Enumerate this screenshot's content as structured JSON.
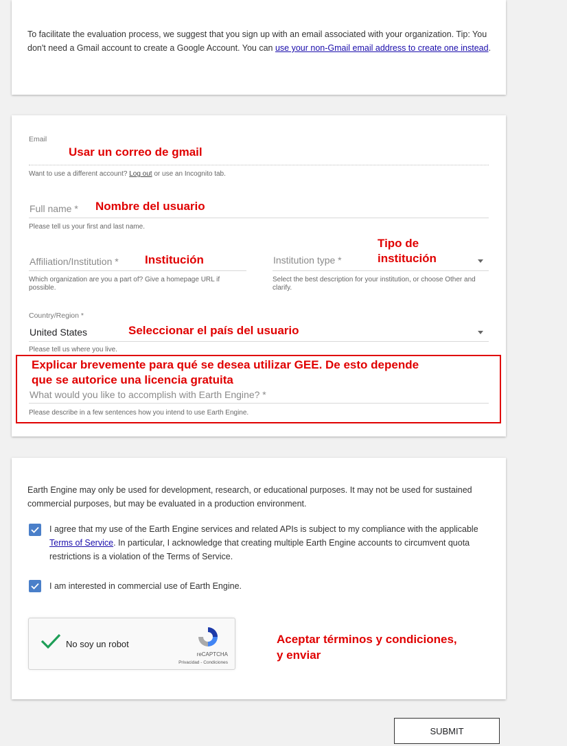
{
  "intro": {
    "text": "To facilitate the evaluation process, we suggest that you sign up with an email associated with your organization. Tip: You don't need a Gmail account to create a Google Account. You can ",
    "link": "use your non-Gmail email address to create one instead",
    "end": "."
  },
  "form": {
    "email_label": "Email",
    "email_help_prefix": "Want to use a different account? ",
    "email_help_link": "Log out",
    "email_help_suffix": " or use an Incognito tab.",
    "fullname_placeholder": "Full name *",
    "fullname_help": "Please tell us your first and last name.",
    "affiliation_placeholder": "Affiliation/Institution *",
    "affiliation_help": "Which organization are you a part of? Give a homepage URL if possible.",
    "institution_type_placeholder": "Institution type *",
    "institution_type_help": "Select the best description for your institution, or choose Other and clarify.",
    "country_label": "Country/Region *",
    "country_value": "United States",
    "country_help": "Please tell us where you live.",
    "accomplish_placeholder": "What would you like to accomplish with Earth Engine? *",
    "accomplish_help": "Please describe in a few sentences how you intend to use Earth Engine."
  },
  "annotations": {
    "email": "Usar un correo de gmail",
    "fullname": "Nombre del usuario",
    "institution": "Institución",
    "institution_type_1": "Tipo de",
    "institution_type_2": "institución",
    "country": "Seleccionar el país del usuario",
    "accomplish_1": "Explicar brevemente para qué se desea utilizar GEE. De esto depende",
    "accomplish_2": "que se autorice una licencia gratuita",
    "terms_1": "Aceptar términos y condiciones,",
    "terms_2": "y enviar"
  },
  "terms": {
    "notice": "Earth Engine may only be used for development, research, or educational purposes. It may not be used for sustained commercial purposes, but may be evaluated in a production environment.",
    "agree_prefix": "I agree that my use of the Earth Engine services and related APIs is subject to my compliance with the applicable ",
    "agree_link": "Terms of Service",
    "agree_suffix": ". In particular, I acknowledge that creating multiple Earth Engine accounts to circumvent quota restrictions is a violation of the Terms of Service.",
    "commercial": "I am interested in commercial use of Earth Engine."
  },
  "recaptcha": {
    "label": "No soy un robot",
    "brand": "reCAPTCHA",
    "privacy": "Privacidad",
    "separator": " - ",
    "conditions": "Condiciones"
  },
  "submit_label": "SUBMIT",
  "colors": {
    "annotation": "#e00000",
    "checkbox": "#4a7fc9",
    "link": "#1a0dab"
  }
}
